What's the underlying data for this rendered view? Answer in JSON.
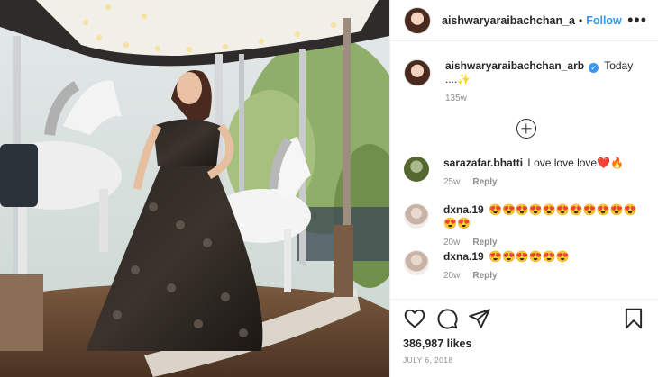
{
  "post": {
    "image_alt": "",
    "author": {
      "username": "aishwaryaraibachchan_arb",
      "follow_label": "Follow",
      "more_label": "•••",
      "separator": "•"
    },
    "caption": {
      "username": "aishwaryaraibachchan_arb",
      "verified_glyph": "✓",
      "text": "Today ....✨",
      "age": "135w"
    },
    "comments": [
      {
        "username": "sarazafar.bhatti",
        "text": "Love love love❤️🔥",
        "age": "25w",
        "reply_label": "Reply"
      },
      {
        "username": "dxna.19",
        "text": "😍😍😍😍😍😍😍😍😍😍😍😍😍",
        "age": "20w",
        "reply_label": "Reply"
      },
      {
        "username": "dxna.19",
        "text": "😍😍😍😍😍😍",
        "age": "20w",
        "reply_label": "Reply"
      }
    ],
    "likes": "386,987 likes",
    "date": "JULY 6, 2018"
  },
  "icons": {
    "like": "heart-icon",
    "comment": "comment-icon",
    "share": "share-icon",
    "save": "bookmark-icon",
    "load_more": "plus-circle-icon"
  },
  "colors": {
    "link": "#3897f0",
    "text": "#262626",
    "muted": "#8e8e8e",
    "divider": "#efefef"
  }
}
